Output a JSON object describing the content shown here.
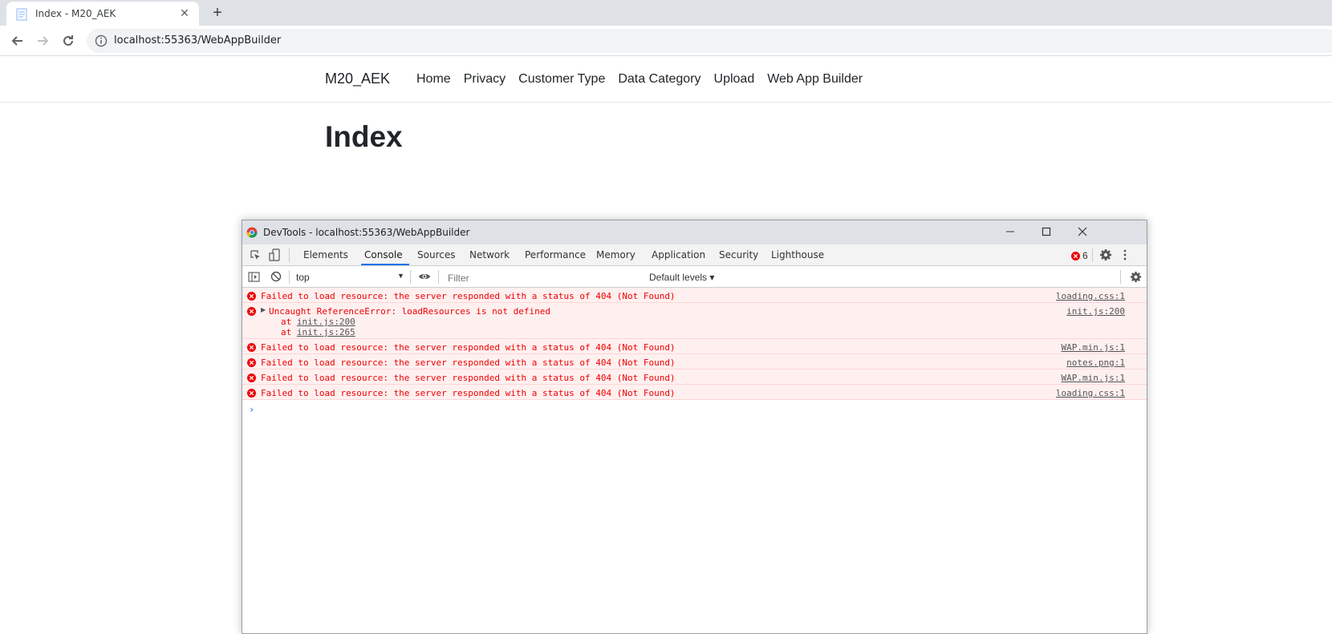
{
  "browser": {
    "tab_title": "Index - M20_AEK",
    "url": "localhost:55363/WebAppBuilder"
  },
  "site": {
    "brand": "M20_AEK",
    "nav": [
      "Home",
      "Privacy",
      "Customer Type",
      "Data Category",
      "Upload",
      "Web App Builder"
    ],
    "page_title": "Index"
  },
  "devtools": {
    "window_title": "DevTools - localhost:55363/WebAppBuilder",
    "tabs": [
      "Elements",
      "Console",
      "Sources",
      "Network",
      "Performance",
      "Memory",
      "Application",
      "Security",
      "Lighthouse"
    ],
    "active_tab": "Console",
    "error_count": "6",
    "context": "top",
    "filter_placeholder": "Filter",
    "levels": "Default levels",
    "messages": [
      {
        "text": "Failed to load resource: the server responded with a status of 404 (Not Found)",
        "source": "loading.css:1"
      },
      {
        "text": "Uncaught ReferenceError: loadResources is not defined",
        "source": "init.js:200",
        "stack_prefix": "at",
        "stack": [
          "init.js:200",
          "init.js:265"
        ]
      },
      {
        "text": "Failed to load resource: the server responded with a status of 404 (Not Found)",
        "source": "WAP.min.js:1"
      },
      {
        "text": "Failed to load resource: the server responded with a status of 404 (Not Found)",
        "source": "notes.png:1"
      },
      {
        "text": "Failed to load resource: the server responded with a status of 404 (Not Found)",
        "source": "WAP.min.js:1"
      },
      {
        "text": "Failed to load resource: the server responded with a status of 404 (Not Found)",
        "source": "loading.css:1"
      }
    ]
  },
  "colors": {
    "error_text": "#ee0000",
    "error_bg": "#fff0f0",
    "accent": "#1a73e8"
  }
}
